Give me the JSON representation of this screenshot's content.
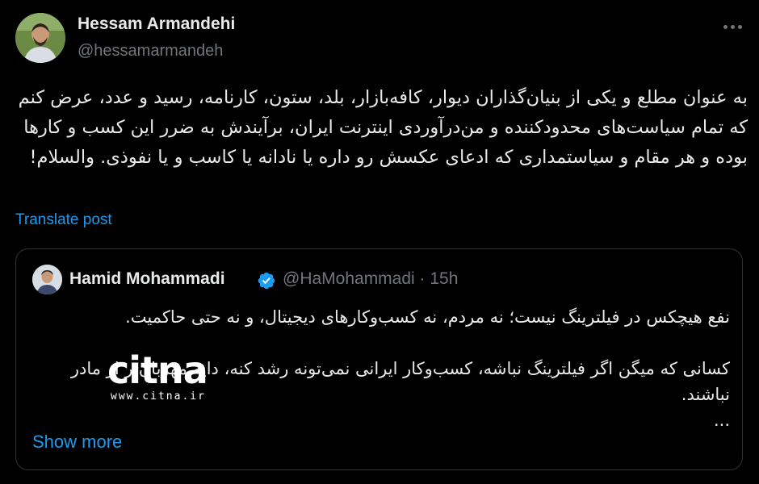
{
  "tweet": {
    "author_name": "Hessam Armandehi",
    "author_handle": "@hessamarmandeh",
    "text": "به عنوان مطلع و یکی از بنیان‌گذاران دیوار، کافه‌بازار، بلد، ستون، کارنامه، رسید و عدد، عرض کنم که تمام سیاست‌های محدودکننده و من‌درآوردی اینترنت ایران، برآیندش به ضرر این کسب و کارها بوده و هر مقام و سیاستمداری که ادعای عکسش رو داره یا نادانه یا کاسب و یا نفوذی. والسلام!",
    "translate_label": "Translate post",
    "more_icon": "ellipsis-icon"
  },
  "quote": {
    "author_name": "Hamid Mohammadi",
    "author_handle": "@HaMohammadi · 15h",
    "verified_icon": "verified-badge-icon",
    "verified_color": "#1d9bf0",
    "paragraph1": "نفع هیچکس در فیلترینگ نیست؛ نه مردم، نه کسب‌وکارهای دیجیتال، و نه حتی حاکمیت.",
    "paragraph2": "کسانی که میگن اگر فیلترینگ نباشه، کسب‌وکار ایرانی نمی‌تونه رشد کنه، دایه مهربان‌تر از مادر نباشند.",
    "ellipsis": "...",
    "show_more_label": "Show more"
  },
  "watermark": {
    "logo_text": "citna",
    "url": "www.citna.ir"
  },
  "colors": {
    "background": "#000000",
    "text": "#e7e9ea",
    "muted": "#71767b",
    "link": "#1d9bf0",
    "border": "#2f3336"
  }
}
